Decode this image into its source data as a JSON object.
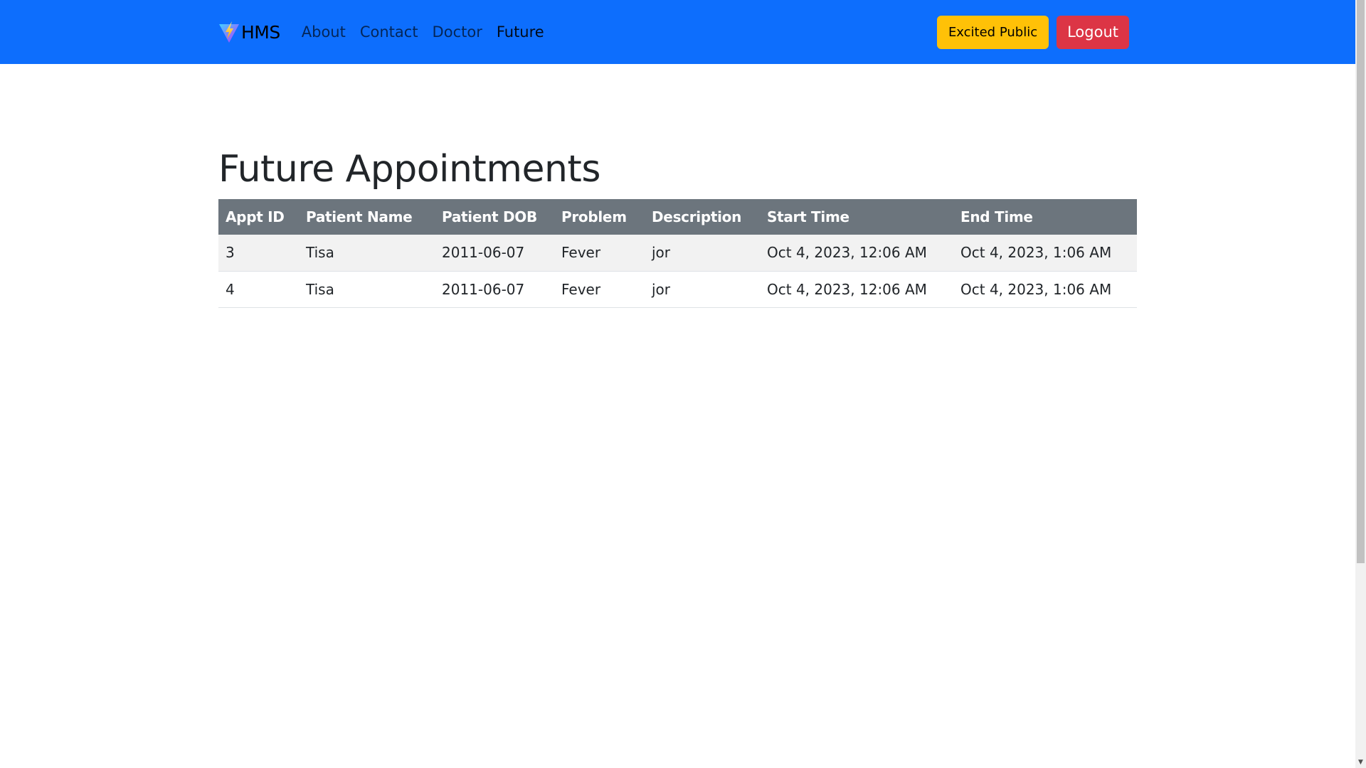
{
  "navbar": {
    "brand": "HMS",
    "links": [
      {
        "label": "About",
        "active": false
      },
      {
        "label": "Contact",
        "active": false
      },
      {
        "label": "Doctor",
        "active": false
      },
      {
        "label": "Future",
        "active": true
      }
    ],
    "user_button": "Excited Public",
    "logout_button": "Logout"
  },
  "page": {
    "title": "Future Appointments"
  },
  "table": {
    "columns": [
      "Appt ID",
      "Patient Name",
      "Patient DOB",
      "Problem",
      "Description",
      "Start Time",
      "End Time"
    ],
    "rows": [
      [
        "3",
        "Tisa",
        "2011-06-07",
        "Fever",
        "jor",
        "Oct 4, 2023, 12:06 AM",
        "Oct 4, 2023, 1:06 AM"
      ],
      [
        "4",
        "Tisa",
        "2011-06-07",
        "Fever",
        "jor",
        "Oct 4, 2023, 12:06 AM",
        "Oct 4, 2023, 1:06 AM"
      ]
    ]
  },
  "colors": {
    "navbar_bg": "#0d6efd",
    "user_button_bg": "#ffc107",
    "logout_button_bg": "#dc3545",
    "table_header_bg": "#6c757d"
  }
}
